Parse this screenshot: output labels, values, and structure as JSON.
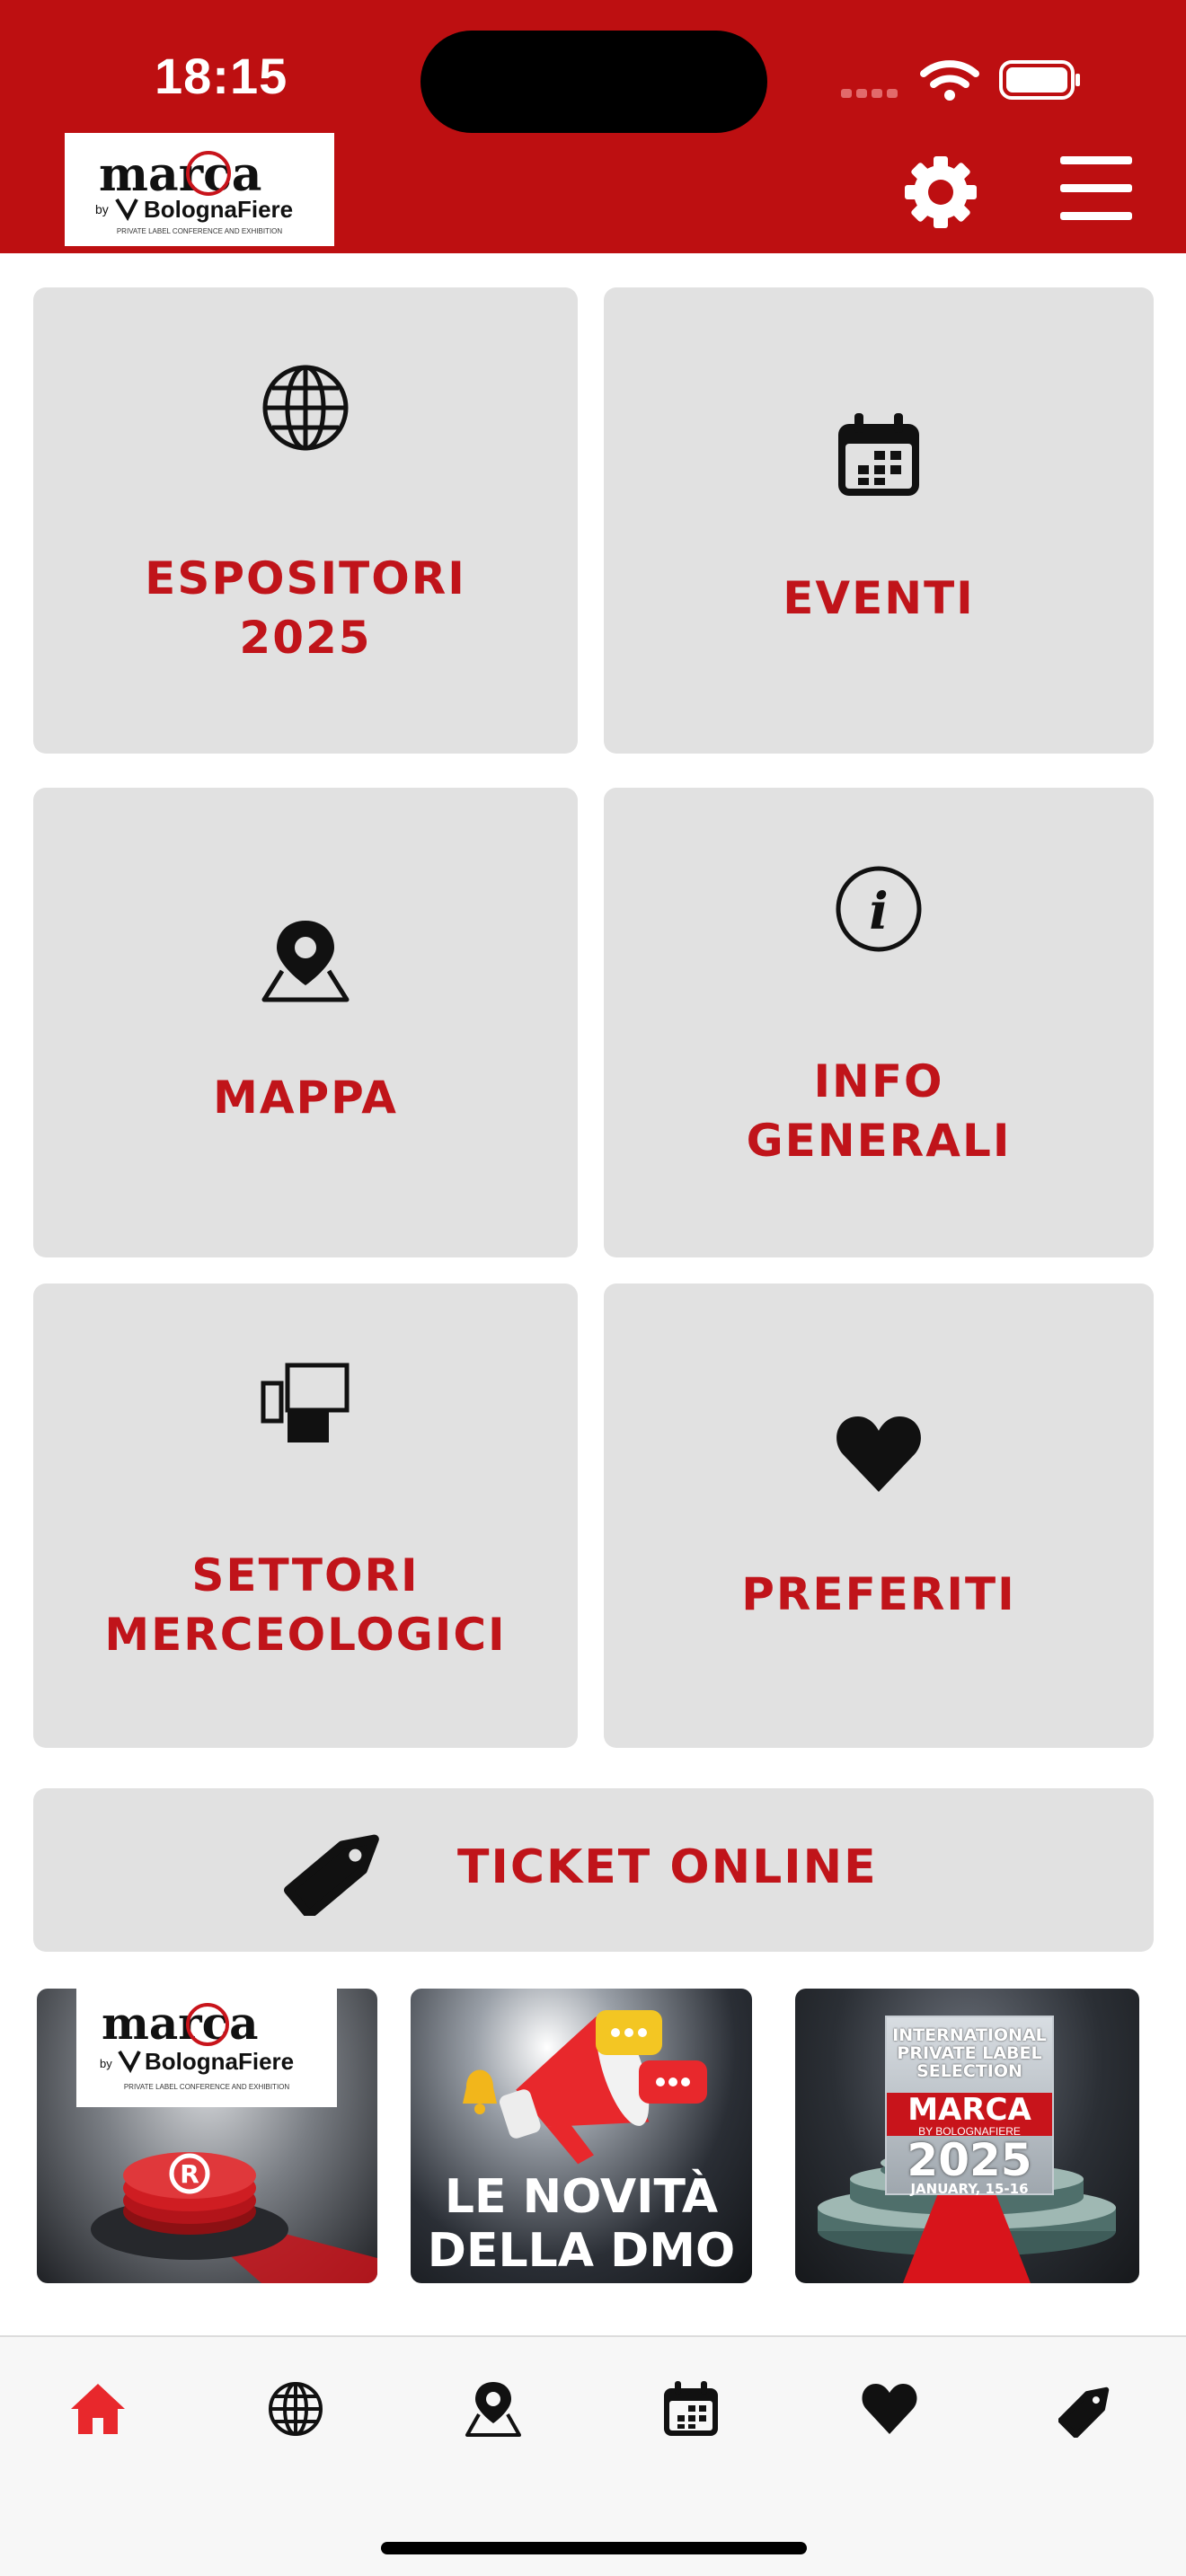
{
  "status_bar": {
    "time": "18:15"
  },
  "header": {
    "logo": {
      "word": "marca",
      "by": "by",
      "brand": "BolognaFiere",
      "tagline": "PRIVATE LABEL CONFERENCE AND EXHIBITION"
    },
    "background": "#bd0f11"
  },
  "tiles": [
    {
      "label": "ESPOSITORI\n2025",
      "icon": "globe-icon"
    },
    {
      "label": "EVENTI",
      "icon": "calendar-icon"
    },
    {
      "label": "MAPPA",
      "icon": "map-pin-icon"
    },
    {
      "label": "INFO\nGENERALI",
      "icon": "info-icon"
    },
    {
      "label": "SETTORI\nMERCEOLOGICI",
      "icon": "sectors-icon"
    },
    {
      "label": "PREFERITI",
      "icon": "heart-icon"
    }
  ],
  "ticket": {
    "label": "TICKET ONLINE",
    "icon": "tag-icon"
  },
  "banners": [
    {
      "logo_word": "marca",
      "logo_by": "by",
      "logo_brand": "BolognaFiere",
      "logo_tagline": "PRIVATE LABEL CONFERENCE AND EXHIBITION"
    },
    {
      "text": "LE NOVITÀ\nDELLA DMO"
    },
    {
      "top": "INTERNATIONAL\nPRIVATE LABEL\nSELECTION",
      "marca": "MARCA",
      "by": "BY BOLOGNAFIERE",
      "year": "2025",
      "date": "JANUARY, 15-16"
    }
  ],
  "bottom_nav": [
    {
      "name": "home",
      "icon": "home-icon",
      "active": true
    },
    {
      "name": "espositori",
      "icon": "globe-icon",
      "active": false
    },
    {
      "name": "mappa",
      "icon": "map-pin-icon",
      "active": false
    },
    {
      "name": "eventi",
      "icon": "calendar-icon",
      "active": false
    },
    {
      "name": "preferiti",
      "icon": "heart-icon",
      "active": false
    },
    {
      "name": "ticket",
      "icon": "tag-icon",
      "active": false
    }
  ],
  "colors": {
    "accent": "#c0141a",
    "tile_bg": "#e1e1e1",
    "nav_active": "#e8282c"
  }
}
